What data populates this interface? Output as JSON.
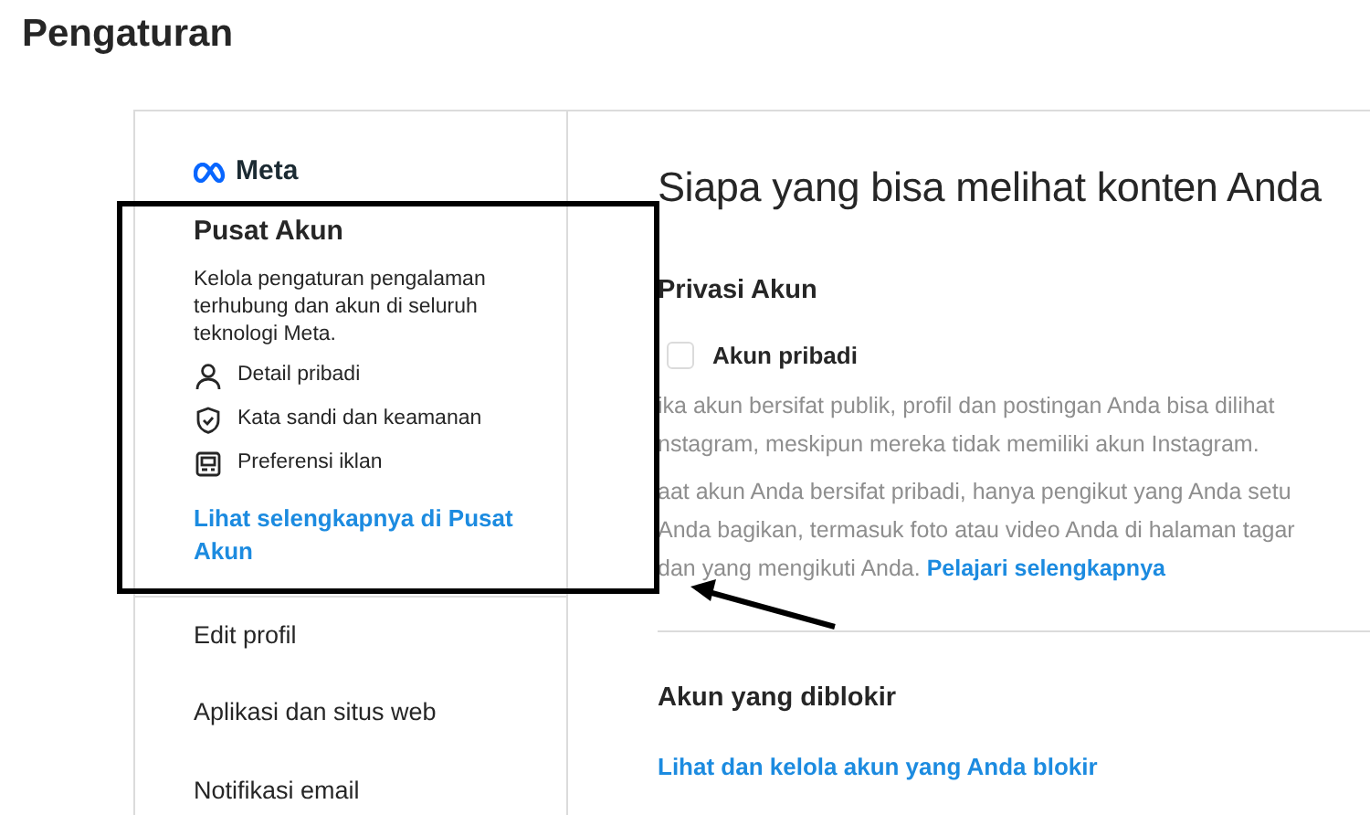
{
  "page_title": "Pengaturan",
  "sidebar": {
    "brand": "Meta",
    "heading": "Pusat Akun",
    "description": "Kelola pengaturan pengalaman terhubung dan akun di seluruh teknologi Meta.",
    "items": [
      {
        "kind": "person",
        "label": "Detail pribadi"
      },
      {
        "kind": "shield",
        "label": "Kata sandi dan keamanan"
      },
      {
        "kind": "ad",
        "label": "Preferensi iklan"
      }
    ],
    "link": "Lihat selengkapnya di Pusat Akun",
    "menu": [
      {
        "label": "Edit profil"
      },
      {
        "label": "Aplikasi dan situs web"
      },
      {
        "label": "Notifikasi email"
      }
    ]
  },
  "content": {
    "title": "Siapa yang bisa melihat konten Anda",
    "privacy": {
      "heading": "Privasi Akun",
      "checkbox": {
        "label": "Akun pribadi",
        "checked": false
      },
      "paragraph_1": [
        "ika akun bersifat publik, profil dan postingan Anda bisa dilihat",
        "nstagram, meskipun mereka tidak memiliki akun Instagram."
      ],
      "paragraph_2": [
        "aat akun Anda bersifat pribadi, hanya pengikut yang Anda setu",
        "Anda bagikan, termasuk foto atau video Anda di halaman tagar",
        "dan yang mengikuti Anda."
      ],
      "link": "Pelajari selengkapnya"
    },
    "blocked": {
      "heading": "Akun yang diblokir",
      "link": "Lihat dan kelola akun yang Anda blokir"
    }
  },
  "annotations": {
    "highlight_frame": true,
    "arrow": true
  }
}
